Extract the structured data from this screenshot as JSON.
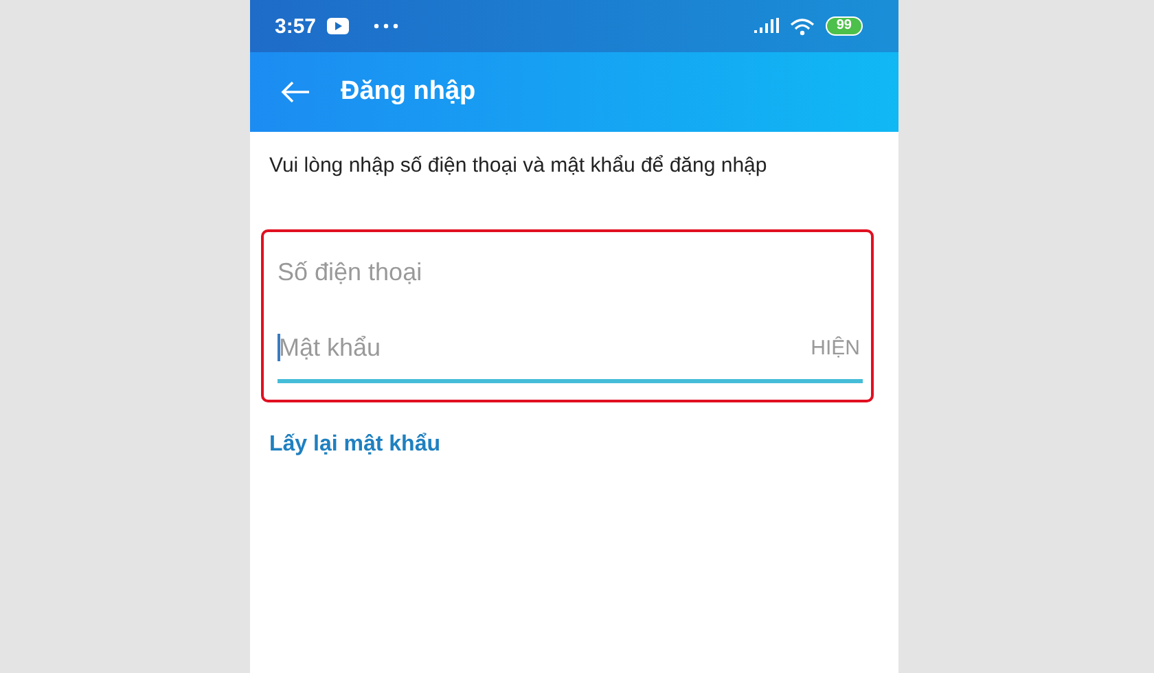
{
  "status_bar": {
    "time": "3:57",
    "battery": "99"
  },
  "app_bar": {
    "title": "Đăng nhập"
  },
  "instruction": "Vui lòng nhập số điện thoại và mật khẩu để đăng nhập",
  "fields": [
    {
      "placeholder": "Số điện thoại",
      "focused": false
    },
    {
      "placeholder": "Mật khẩu",
      "focused": true,
      "action": "HIỆN"
    }
  ],
  "forgot_link": "Lấy lại mật khẩu"
}
